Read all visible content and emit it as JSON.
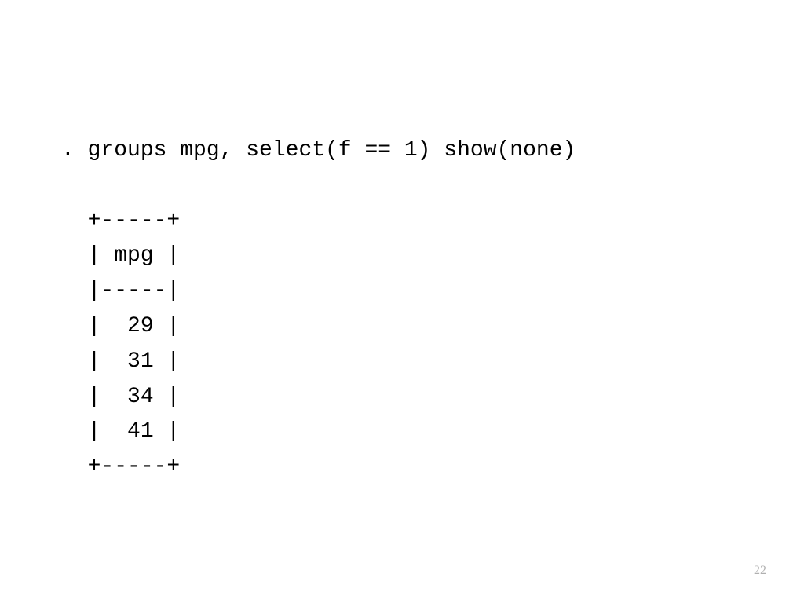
{
  "content": {
    "command": ". groups mpg, select(f == 1) show(none)",
    "blank": "",
    "table_top": "  +-----+",
    "table_header": "  | mpg |",
    "table_divider": "  |-----|",
    "row_1": "  |  29 |",
    "row_2": "  |  31 |",
    "row_3": "  |  34 |",
    "row_4": "  |  41 |",
    "table_bottom": "  +-----+"
  },
  "page_number": "22"
}
